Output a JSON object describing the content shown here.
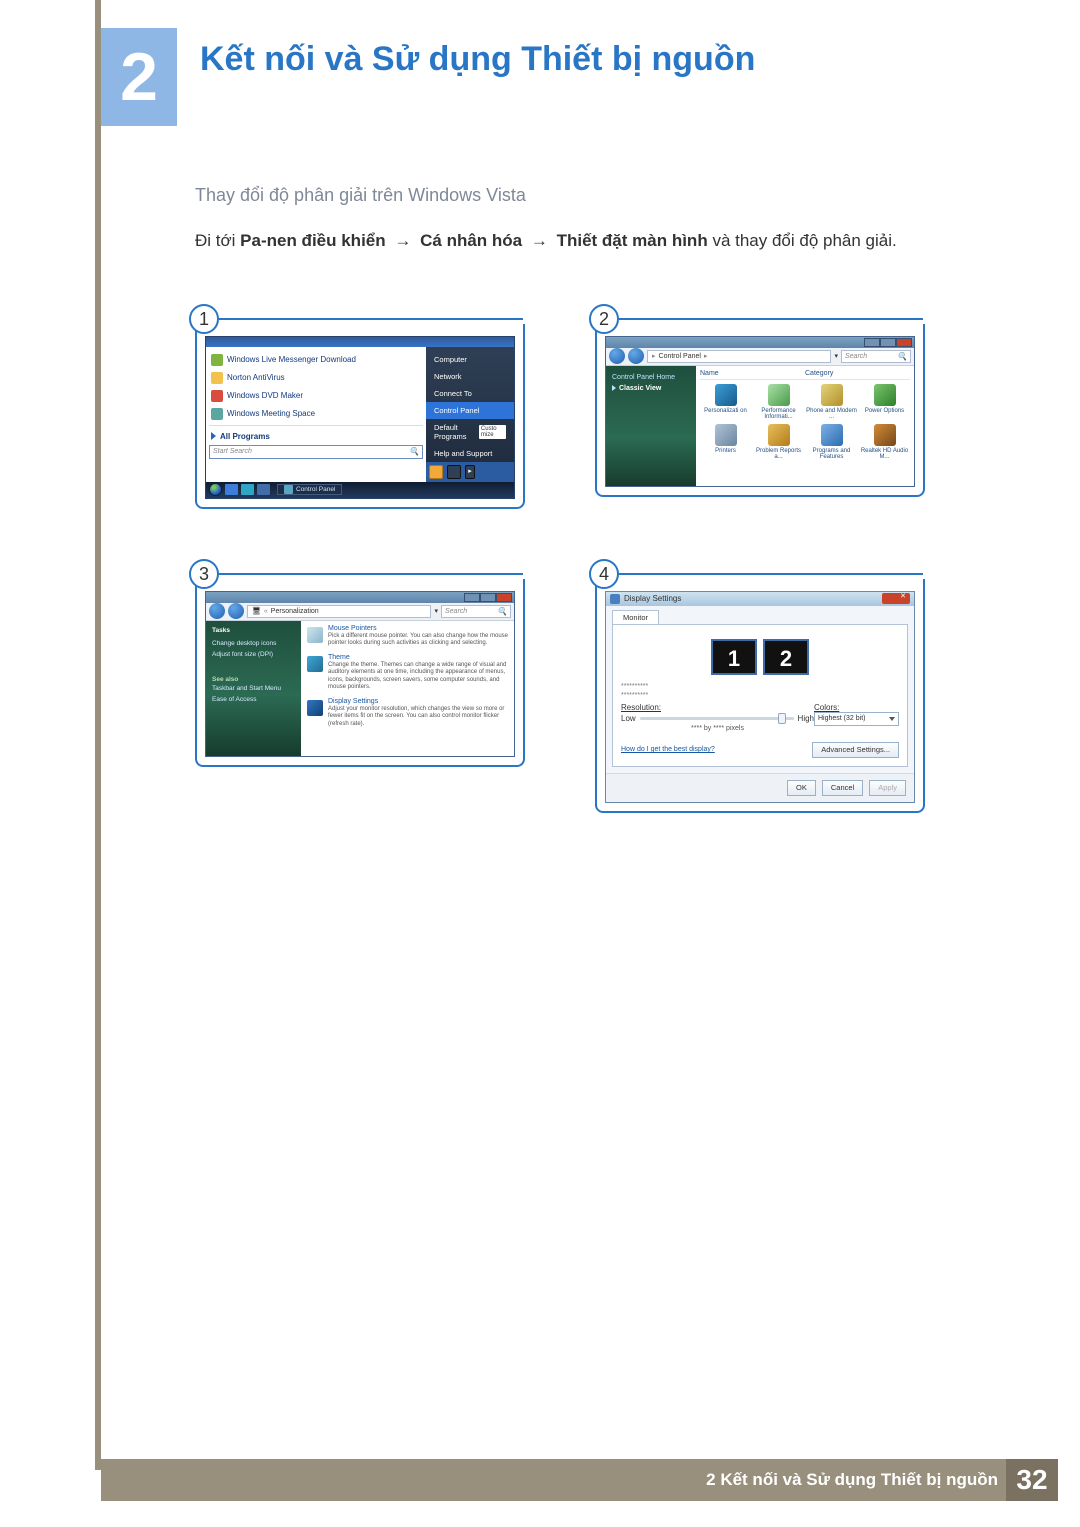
{
  "chapter": {
    "number": "2",
    "title": "Kết nối và Sử dụng Thiết bị nguồn"
  },
  "subheading": "Thay đổi độ phân giải trên Windows Vista",
  "instruction": {
    "prefix": "Đi tới ",
    "b1": "Pa-nen điều khiển",
    "arrow": "→",
    "b2": "Cá nhân hóa",
    "b3": "Thiết đặt màn hình",
    "suffix": " và thay đổi độ phân giải."
  },
  "steps": {
    "s1": "1",
    "s2": "2",
    "s3": "3",
    "s4": "4"
  },
  "startmenu": {
    "items": [
      "Windows Live Messenger Download",
      "Norton AntiVirus",
      "Windows DVD Maker",
      "Windows Meeting Space"
    ],
    "all_programs": "All Programs",
    "search_placeholder": "Start Search",
    "right": {
      "computer": "Computer",
      "network": "Network",
      "connect": "Connect To",
      "control_panel": "Control Panel",
      "default_programs": "Default Programs",
      "customize": "Custo\nmize",
      "help": "Help and Support"
    },
    "taskbar_cp": "Control Panel"
  },
  "control_panel": {
    "breadcrumb": "Control Panel",
    "search_placeholder": "Search",
    "side": {
      "home": "Control Panel Home",
      "classic": "Classic View"
    },
    "cols": {
      "name": "Name",
      "category": "Category"
    },
    "items": [
      "Personalizati\non",
      "Performance\nInformati...",
      "Phone and\nModem ...",
      "Power\nOptions",
      "Printers",
      "Problem\nReports a...",
      "Programs\nand Features",
      "Realtek HD\nAudio M..."
    ]
  },
  "personalization": {
    "breadcrumb": "Personalization",
    "search_placeholder": "Search",
    "side": {
      "tasks": "Tasks",
      "change_icons": "Change desktop icons",
      "adjust_font": "Adjust font size (DPI)",
      "see_also": "See also",
      "taskbar": "Taskbar and Start Menu",
      "ease": "Ease of Access"
    },
    "sections": {
      "mouse_title": "Mouse Pointers",
      "mouse_desc": "Pick a different mouse pointer. You can also change how the mouse pointer looks during such activities as clicking and selecting.",
      "theme_title": "Theme",
      "theme_desc": "Change the theme. Themes can change a wide range of visual and auditory elements at one time, including the appearance of menus, icons, backgrounds, screen savers, some computer sounds, and mouse pointers.",
      "display_title": "Display Settings",
      "display_desc": "Adjust your monitor resolution, which changes the view so more or fewer items fit on the screen. You can also control monitor flicker (refresh rate)."
    }
  },
  "display_settings": {
    "title": "Display Settings",
    "tab": "Monitor",
    "mon1": "1",
    "mon2": "2",
    "mask1": "**********",
    "mask2": "**********",
    "resolution_label": "Resolution:",
    "low": "Low",
    "high": "High",
    "res_value": "**** by **** pixels",
    "colors_label": "Colors:",
    "colors_value": "Highest (32 bit)",
    "help_link": "How do I get the best display?",
    "advanced": "Advanced Settings...",
    "ok": "OK",
    "cancel": "Cancel",
    "apply": "Apply"
  },
  "footer": {
    "text": "2 Kết nối và Sử dụng Thiết bị nguồn",
    "page": "32"
  }
}
